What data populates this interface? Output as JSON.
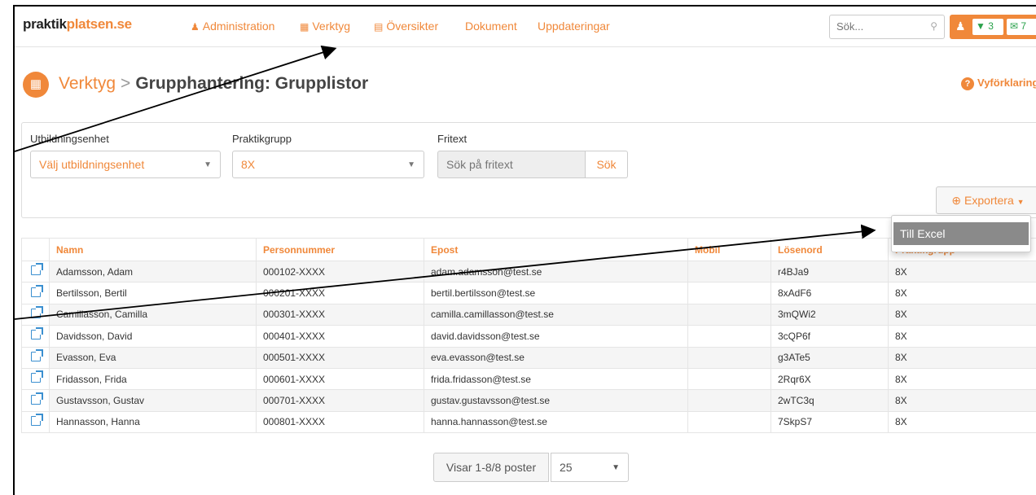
{
  "navbar": {
    "logo_part1": "praktik",
    "logo_part2": "platsen.se",
    "items": [
      {
        "label": "Administration",
        "icon": "user-icon"
      },
      {
        "label": "Verktyg",
        "icon": "calendar-icon"
      },
      {
        "label": "Översikter",
        "icon": "bar-chart-icon"
      },
      {
        "label": "Dokument",
        "icon": ""
      },
      {
        "label": "Uppdateringar",
        "icon": ""
      }
    ],
    "search_placeholder": "Sök...",
    "pin_count": "3",
    "msg_count": "7"
  },
  "page": {
    "crumb": "Verktyg",
    "separator": ">",
    "title": "Grupphantering: Grupplistor",
    "help_label": "Vyförklaring"
  },
  "filters": {
    "unit_label": "Utbildningsenhet",
    "unit_value": "Välj utbildningsenhet",
    "group_label": "Praktikgrupp",
    "group_value": "8X",
    "text_label": "Fritext",
    "text_placeholder": "Sök på fritext",
    "search_button": "Sök",
    "export_button": "Exportera"
  },
  "export_menu": {
    "items": [
      "Till Excel"
    ]
  },
  "table": {
    "columns": [
      "Namn",
      "Personnummer",
      "Epost",
      "Mobil",
      "Lösenord",
      "Praktikgrupp"
    ],
    "rows": [
      [
        "Adamsson, Adam",
        "000102-XXXX",
        "adam.adamsson@test.se",
        "",
        "r4BJa9",
        "8X"
      ],
      [
        "Bertilsson, Bertil",
        "000201-XXXX",
        "bertil.bertilsson@test.se",
        "",
        "8xAdF6",
        "8X"
      ],
      [
        "Camillasson, Camilla",
        "000301-XXXX",
        "camilla.camillasson@test.se",
        "",
        "3mQWi2",
        "8X"
      ],
      [
        "Davidsson, David",
        "000401-XXXX",
        "david.davidsson@test.se",
        "",
        "3cQP6f",
        "8X"
      ],
      [
        "Evasson, Eva",
        "000501-XXXX",
        "eva.evasson@test.se",
        "",
        "g3ATe5",
        "8X"
      ],
      [
        "Fridasson, Frida",
        "000601-XXXX",
        "frida.fridasson@test.se",
        "",
        "2Rqr6X",
        "8X"
      ],
      [
        "Gustavsson, Gustav",
        "000701-XXXX",
        "gustav.gustavsson@test.se",
        "",
        "2wTC3q",
        "8X"
      ],
      [
        "Hannasson, Hanna",
        "000801-XXXX",
        "hanna.hannasson@test.se",
        "",
        "7SkpS7",
        "8X"
      ]
    ]
  },
  "pager": {
    "info": "Visar 1-8/8 poster",
    "page_size": "25"
  },
  "colors": {
    "accent": "#f0883a",
    "link_blue": "#3a8fd0",
    "badge_green": "#2ba24c"
  }
}
